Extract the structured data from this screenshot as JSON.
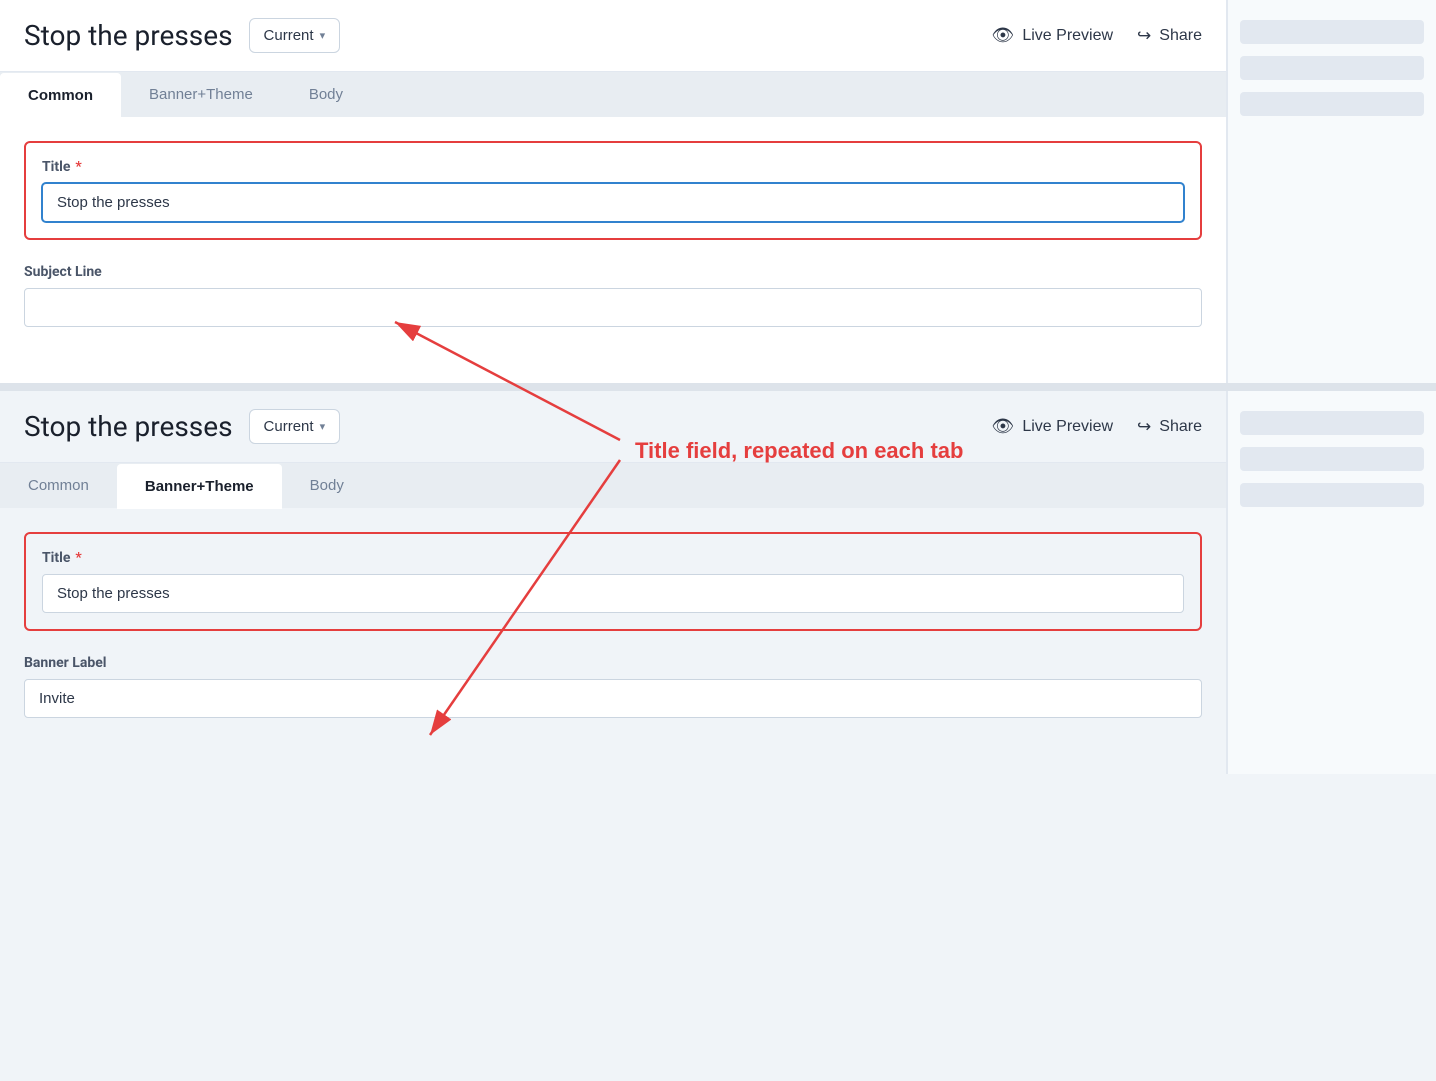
{
  "page": {
    "title": "Stop the presses"
  },
  "section1": {
    "header": {
      "title": "Stop the presses",
      "version_label": "Current",
      "version_chevron": "▾",
      "live_preview_label": "Live Preview",
      "share_label": "Share"
    },
    "tabs": [
      {
        "id": "common",
        "label": "Common",
        "active": true
      },
      {
        "id": "banner-theme",
        "label": "Banner+Theme",
        "active": false
      },
      {
        "id": "body",
        "label": "Body",
        "active": false
      }
    ],
    "form": {
      "title_label": "Title",
      "title_required": "*",
      "title_value": "Stop the presses",
      "subject_line_label": "Subject Line",
      "subject_line_value": ""
    }
  },
  "section2": {
    "header": {
      "title": "Stop the presses",
      "version_label": "Current",
      "version_chevron": "▾",
      "live_preview_label": "Live Preview",
      "share_label": "Share"
    },
    "tabs": [
      {
        "id": "common",
        "label": "Common",
        "active": false
      },
      {
        "id": "banner-theme",
        "label": "Banner+Theme",
        "active": true
      },
      {
        "id": "body",
        "label": "Body",
        "active": false
      }
    ],
    "form": {
      "title_label": "Title",
      "title_required": "*",
      "title_value": "Stop the presses",
      "banner_label_label": "Banner Label",
      "banner_label_value": "Invite"
    }
  },
  "annotation": {
    "text": "Title field, repeated on each tab"
  },
  "icons": {
    "eye": "👁",
    "share": "↪"
  }
}
